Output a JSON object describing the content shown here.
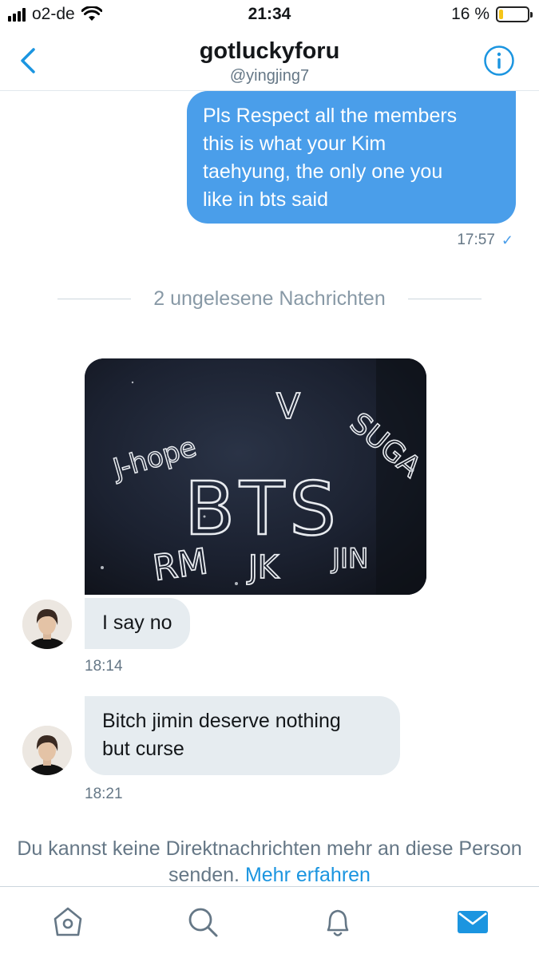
{
  "status_bar": {
    "carrier": "o2-de",
    "time": "21:34",
    "battery_percent": "16 %",
    "battery_level": 0.16
  },
  "header": {
    "title": "gotluckyforu",
    "handle": "@yingjing7"
  },
  "messages": {
    "outgoing_1": {
      "lines": [
        "Pls Respect all the members",
        "this is what your Kim",
        "taehyung, the only one you",
        "like in bts said"
      ],
      "time": "17:57"
    },
    "unread_divider": "2 ungelesene Nachrichten",
    "incoming_image_text": {
      "center": "BTS",
      "j_hope": "J-hope",
      "v": "V",
      "suga": "SUGA",
      "rm": "RM",
      "jk": "JK",
      "jin": "JIN"
    },
    "incoming_1": {
      "text": "I say no",
      "time": "18:14"
    },
    "incoming_2": {
      "lines": [
        "Bitch jimin deserve nothing",
        "but curse"
      ],
      "time": "18:21"
    }
  },
  "notice": {
    "text": "Du kannst keine Direktnachrichten mehr an diese Person senden.",
    "link": "Mehr erfahren"
  },
  "colors": {
    "accent": "#4a9eea",
    "link": "#1b95e0",
    "incoming_bubble": "#e6ecf0"
  },
  "tabbar": {
    "icons": [
      "home-icon",
      "search-icon",
      "bell-icon",
      "mail-icon"
    ],
    "active": "mail-icon"
  }
}
